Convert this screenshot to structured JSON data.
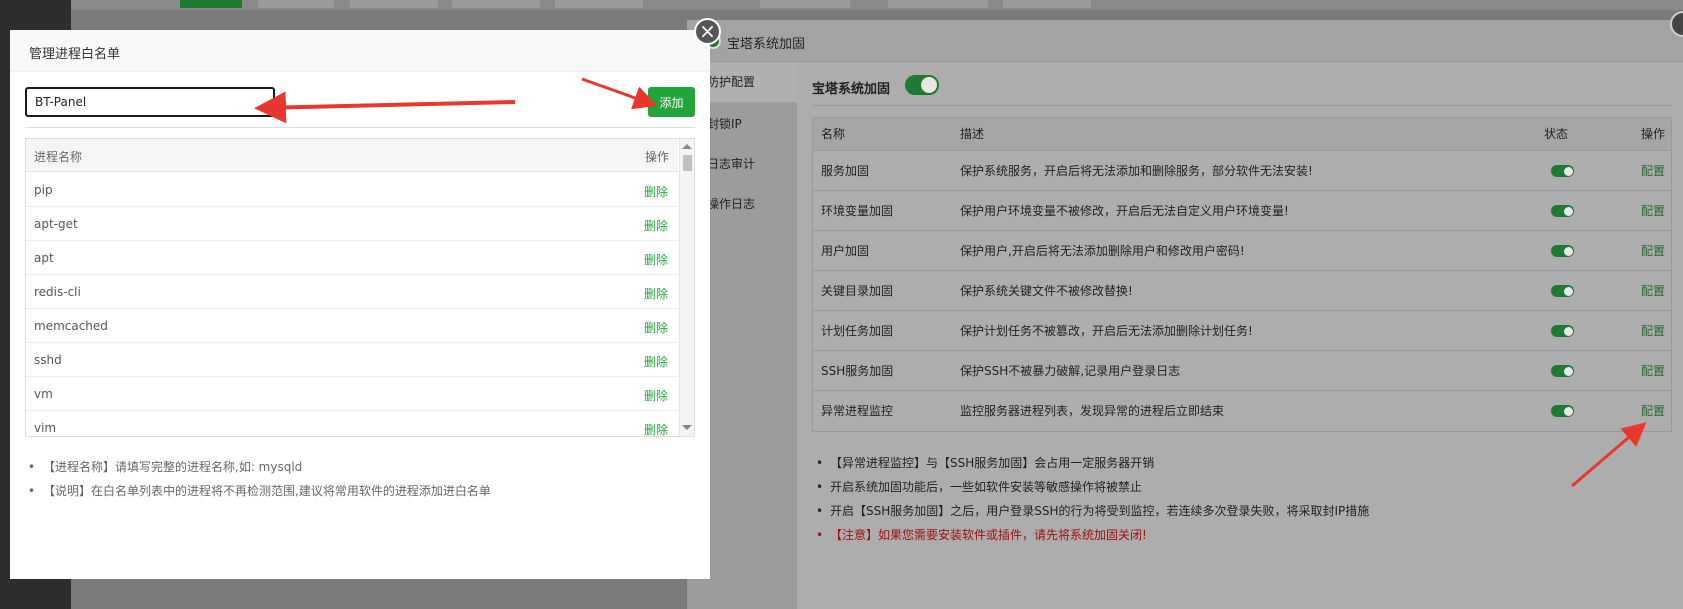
{
  "colors": {
    "accent": "#20a53a",
    "arrow": "#e8382e",
    "warn": "#cc0000"
  },
  "background_panel": {
    "title": "宝塔系统加固",
    "side_items": [
      "防护配置",
      "封锁IP",
      "日志审计",
      "操作日志"
    ],
    "main_label": "宝塔系统加固",
    "main_toggle_on": true,
    "table": {
      "headers": [
        "名称",
        "描述",
        "状态",
        "操作"
      ],
      "rows": [
        {
          "name": "服务加固",
          "desc": "保护系统服务，开启后将无法添加和删除服务，部分软件无法安装!",
          "on": true,
          "action": "配置"
        },
        {
          "name": "环境变量加固",
          "desc": "保护用户环境变量不被修改，开启后无法自定义用户环境变量!",
          "on": true,
          "action": "配置"
        },
        {
          "name": "用户加固",
          "desc": "保护用户,开启后将无法添加删除用户和修改用户密码!",
          "on": true,
          "action": "配置"
        },
        {
          "name": "关键目录加固",
          "desc": "保护系统关键文件不被修改替换!",
          "on": true,
          "action": "配置"
        },
        {
          "name": "计划任务加固",
          "desc": "保护计划任务不被篡改，开启后无法添加删除计划任务!",
          "on": true,
          "action": "配置"
        },
        {
          "name": "SSH服务加固",
          "desc": "保护SSH不被暴力破解,记录用户登录日志",
          "on": true,
          "action": "配置"
        },
        {
          "name": "异常进程监控",
          "desc": "监控服务器进程列表，发现异常的进程后立即结束",
          "on": true,
          "action": "配置"
        }
      ]
    },
    "notes": [
      "【异常进程监控】与【SSH服务加固】会占用一定服务器开销",
      "开启系统加固功能后，一些如软件安装等敏感操作将被禁止",
      "开启【SSH服务加固】之后，用户登录SSH的行为将受到监控，若连续多次登录失败，将采取封IP措施"
    ],
    "warning": "【注意】如果您需要安装软件或插件，请先将系统加固关闭!"
  },
  "modal": {
    "title": "管理进程白名单",
    "close_icon": "close-icon",
    "input_value": "BT-Panel",
    "add_label": "添加",
    "list_headers": {
      "name": "进程名称",
      "action": "操作"
    },
    "processes": [
      "pip",
      "apt-get",
      "apt",
      "redis-cli",
      "memcached",
      "sshd",
      "vm",
      "vim"
    ],
    "delete_label": "删除",
    "help": [
      "【进程名称】请填写完整的进程名称,如: mysqld",
      "【说明】在白名单列表中的进程将不再检测范围,建议将常用软件的进程添加进白名单"
    ]
  }
}
